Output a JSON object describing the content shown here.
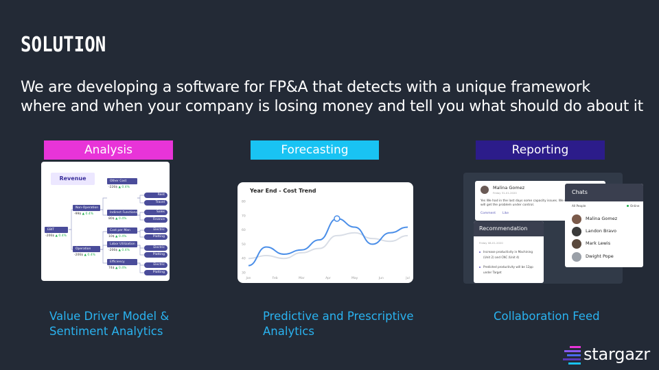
{
  "slide": {
    "title": "SOLUTION",
    "subtitle_line1": "We are developing a software for FP&A that detects with a unique framework",
    "subtitle_line2": "where and when your company is losing money and tell you what should do about it"
  },
  "colors": {
    "background": "#232a36",
    "analysis": "#e834d8",
    "forecasting": "#19c3f3",
    "reporting": "#2c1c8a",
    "caption": "#2ab3f0"
  },
  "sections": [
    {
      "label": "Analysis",
      "caption_line1": "Value Driver Model &",
      "caption_line2": "Sentiment Analytics"
    },
    {
      "label": "Forecasting",
      "caption_line1": "Predictive and Prescriptive",
      "caption_line2": "Analytics"
    },
    {
      "label": "Reporting",
      "caption_line1": "Collaboration Feed"
    }
  ],
  "analysis_card": {
    "tag": "Revenue",
    "root": {
      "label": "EBIT",
      "value": "-206$",
      "delta": "▲ 0.4%"
    },
    "mid": [
      {
        "label": "Non-Operation",
        "value": "-99$",
        "delta": "▲ 0.4%"
      },
      {
        "label": "Operation",
        "value": "-206$",
        "delta": "▲ 0.4%"
      }
    ],
    "sub": [
      {
        "label": "Other Cost Center",
        "value": "-226$",
        "delta": "▲ 0.4%"
      },
      {
        "label": "Indirect Functions",
        "value": "80$",
        "delta": "▲ 0.4%"
      },
      {
        "label": "Cost per Man Hour",
        "value": "10$",
        "delta": "▲ 0.4%"
      },
      {
        "label": "Labor Utilization",
        "value": "-206$",
        "delta": "▲ 0.4%"
      },
      {
        "label": "Efficiency",
        "value": "74$",
        "delta": "▲ 0.4%"
      }
    ],
    "leaves": [
      "Rent",
      "Travel",
      "Sales",
      "Finance",
      "Electric",
      "Platting",
      "Electric",
      "Platting",
      "Electric",
      "Platting"
    ]
  },
  "forecast_card": {
    "title": "Year End - Cost Trend",
    "chart_data": {
      "type": "line",
      "title": "Year End - Cost Trend",
      "x": [
        "Jan",
        "Feb",
        "Mar",
        "Apr",
        "May",
        "Jun",
        "Jul"
      ],
      "y_ticks": [
        30,
        40,
        50,
        60,
        70,
        80
      ],
      "series": [
        {
          "values": [
            35,
            48,
            43,
            46,
            53,
            68,
            62,
            50,
            58,
            62
          ]
        },
        {
          "values": [
            40,
            42,
            40,
            44,
            47,
            56,
            58,
            54,
            52,
            56
          ]
        }
      ],
      "ylim": [
        30,
        80
      ]
    }
  },
  "report_card": {
    "post_author": "Malina Gomez",
    "post_date": "Friday 31-01-2020",
    "post_text_1": "Yes We had in the last days some capacity issues. We w",
    "post_text_2": "will get the problem under control.",
    "post_comment": "Comment",
    "post_like": "Like",
    "rec_title": "Recommendation",
    "rec_date": "Friday 08-01-2020",
    "rec_item1_a": "Increase productivity in Machining",
    "rec_item1_b": "(Unit 2) and CNC (Unit 4)",
    "rec_item2_a": "Predicted productivity will be 12pp",
    "rec_item2_b": "under Target",
    "chats_title": "Chats",
    "chats_filter": "All People",
    "chats_online": "Online",
    "chats": [
      "Malina Gomez",
      "Landon Bravo",
      "Mark Lewis",
      "Dwight Pope"
    ]
  },
  "logo": {
    "text": "stargazr"
  }
}
